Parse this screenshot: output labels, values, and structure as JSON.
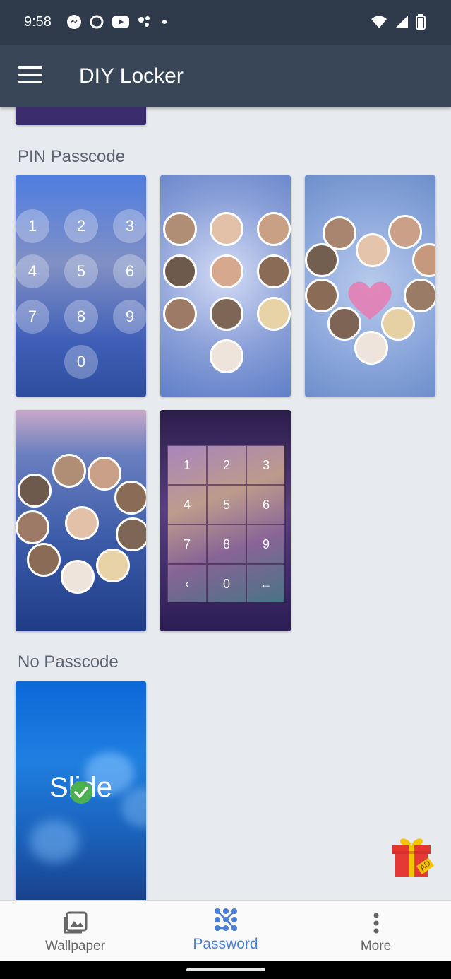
{
  "status_bar": {
    "time": "9:58",
    "icons": [
      "messenger-icon",
      "circle-app-icon",
      "youtube-icon",
      "assistant-icon",
      "dot-icon",
      "wifi-icon",
      "signal-icon",
      "battery-icon"
    ]
  },
  "app_bar": {
    "title": "DIY Locker",
    "menu_icon": "hamburger-menu-icon"
  },
  "sections": {
    "pin": {
      "title": "PIN Passcode"
    },
    "no_pass": {
      "title": "No Passcode"
    }
  },
  "themes": {
    "pin1": {
      "digits": [
        "1",
        "2",
        "3",
        "4",
        "5",
        "6",
        "7",
        "8",
        "9",
        "0"
      ]
    },
    "pin5": {
      "digits": [
        "1",
        "2",
        "3",
        "4",
        "5",
        "6",
        "7",
        "8",
        "9",
        "‹",
        "0",
        "←"
      ]
    },
    "slide": {
      "label": "Slide",
      "selected": true
    }
  },
  "ad_badge": "AD",
  "bottom_nav": {
    "items": [
      {
        "label": "Wallpaper",
        "icon": "image-icon"
      },
      {
        "label": "Password",
        "icon": "pattern-lock-icon",
        "active": true
      },
      {
        "label": "More",
        "icon": "more-vertical-icon"
      }
    ],
    "active_color": "#4a7fd4",
    "inactive_color": "#666666"
  }
}
